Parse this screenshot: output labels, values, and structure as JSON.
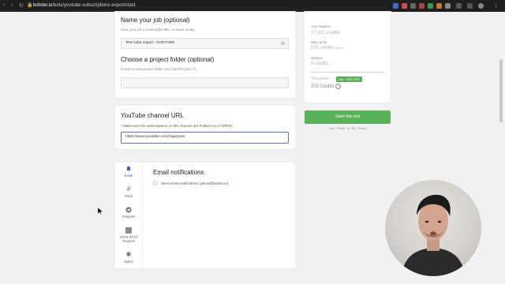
{
  "browser": {
    "url_host": "botster.io",
    "url_path": "/bots/youtube-subscriptions-export/start"
  },
  "job_name": {
    "title": "Name your job (optional)",
    "help": "Give your job a meaningful title, or leave empty.",
    "value": "Test subs export - GARYVEE"
  },
  "project_folder": {
    "title": "Choose a project folder (optional)",
    "help": "Create a new project folder and add this job to it.",
    "value": ""
  },
  "channel": {
    "title": "YouTube channel URL",
    "note": "* Make sure the subscriptions on this channel are PUBLICALLY OPEN!",
    "value": "https://www.youtube.com/c/garyvee"
  },
  "notifications": {
    "side": [
      {
        "label": "Email",
        "icon": "bell-icon"
      },
      {
        "label": "Slack",
        "icon": "slack-icon"
      },
      {
        "label": "Telegram",
        "icon": "telegram-icon"
      },
      {
        "label": "JSON POST Request",
        "icon": "json-icon"
      },
      {
        "label": "Zapier",
        "icon": "zapier-icon"
      }
    ],
    "title": "Email notifications",
    "checkbox_label": "Send email notifications (denis@botster.io)"
  },
  "summary": {
    "balance_label": "Your balance",
    "balance_value": "27,611 credits",
    "base_price_label": "Base price",
    "base_price_value": "200 credits",
    "base_price_unit": "per run",
    "options_label": "Options",
    "options_value": "0 credits",
    "total_label": "Total price:",
    "badge": "Get −20% OFF",
    "total_value": "200 credits"
  },
  "start_button": "Start this bot",
  "shortcut_hint": "\"Ctrl + Enter\" or \"⌘ + Enter\"",
  "colors": {
    "accent": "#59b25a",
    "focus": "#5b6cd8",
    "active_tab": "#3a56d4"
  }
}
